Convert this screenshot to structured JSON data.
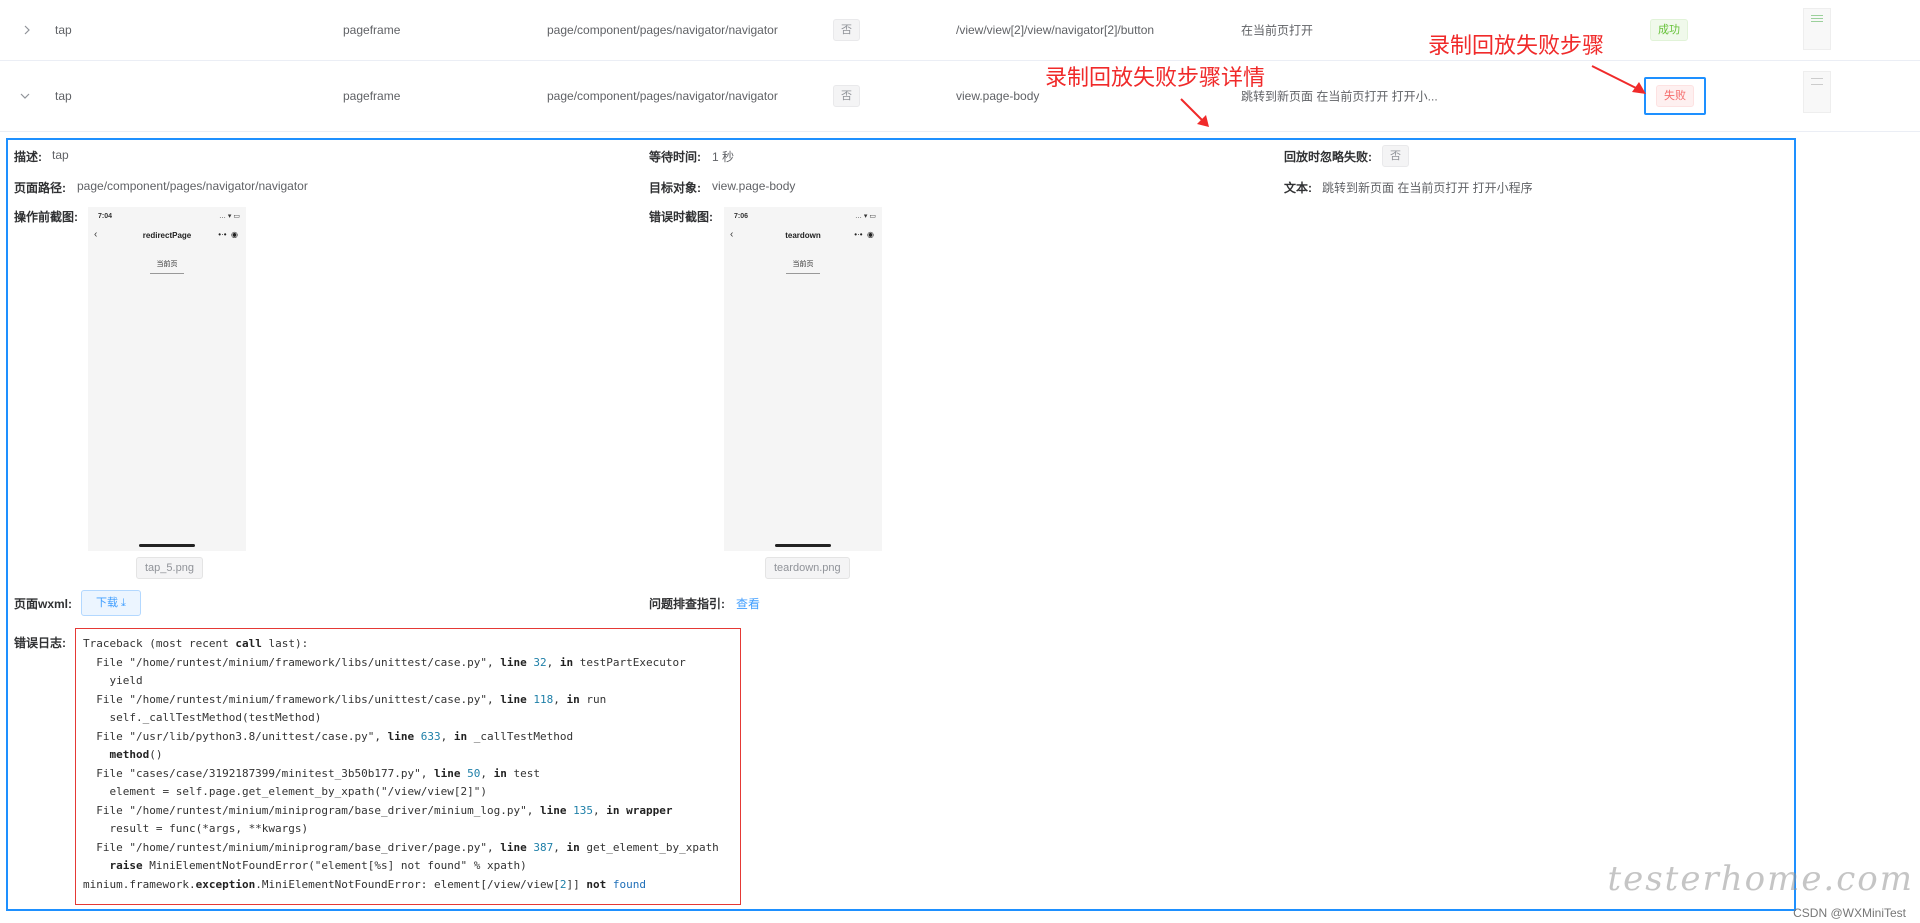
{
  "rows": [
    {
      "action": "tap",
      "type": "pageframe",
      "path": "page/component/pages/navigator/navigator",
      "ignore": "否",
      "target": "/view/view[2]/view/navigator[2]/button",
      "text": "在当前页打开",
      "status": "成功",
      "status_kind": "success"
    },
    {
      "action": "tap",
      "type": "pageframe",
      "path": "page/component/pages/navigator/navigator",
      "ignore": "否",
      "target": "view.page-body",
      "text": "跳转到新页面 在当前页打开 打开小...",
      "status": "失败",
      "status_kind": "danger"
    }
  ],
  "detail": {
    "desc_label": "描述:",
    "desc_value": "tap",
    "wait_label": "等待时间:",
    "wait_value": "1 秒",
    "ignore_label": "回放时忽略失败:",
    "ignore_value": "否",
    "path_label": "页面路径:",
    "path_value": "page/component/pages/navigator/navigator",
    "target_label": "目标对象:",
    "target_value": "view.page-body",
    "text_label": "文本:",
    "text_value": "跳转到新页面 在当前页打开 打开小程序",
    "before_label": "操作前截图:",
    "error_shot_label": "错误时截图:",
    "before_shot": {
      "time": "7:04",
      "title": "redirectPage",
      "button": "当前页",
      "file": "tap_5.png"
    },
    "error_shot": {
      "time": "7:06",
      "title": "teardown",
      "button": "当前页",
      "file": "teardown.png"
    },
    "wxml_label": "页面wxml:",
    "download_label": "下载 ⤓",
    "guide_label": "问题排查指引:",
    "guide_link": "查看",
    "log_label": "错误日志:"
  },
  "annotations": {
    "failed_step": "录制回放失败步骤",
    "failed_detail": "录制回放失败步骤详情"
  },
  "watermark": "testerhome.com",
  "credit": "CSDN @WXMiniTest",
  "colors": {
    "frame": "#1e90ff",
    "annotation": "#f02a2a",
    "success": "#67c23a",
    "danger": "#f56c6c"
  }
}
